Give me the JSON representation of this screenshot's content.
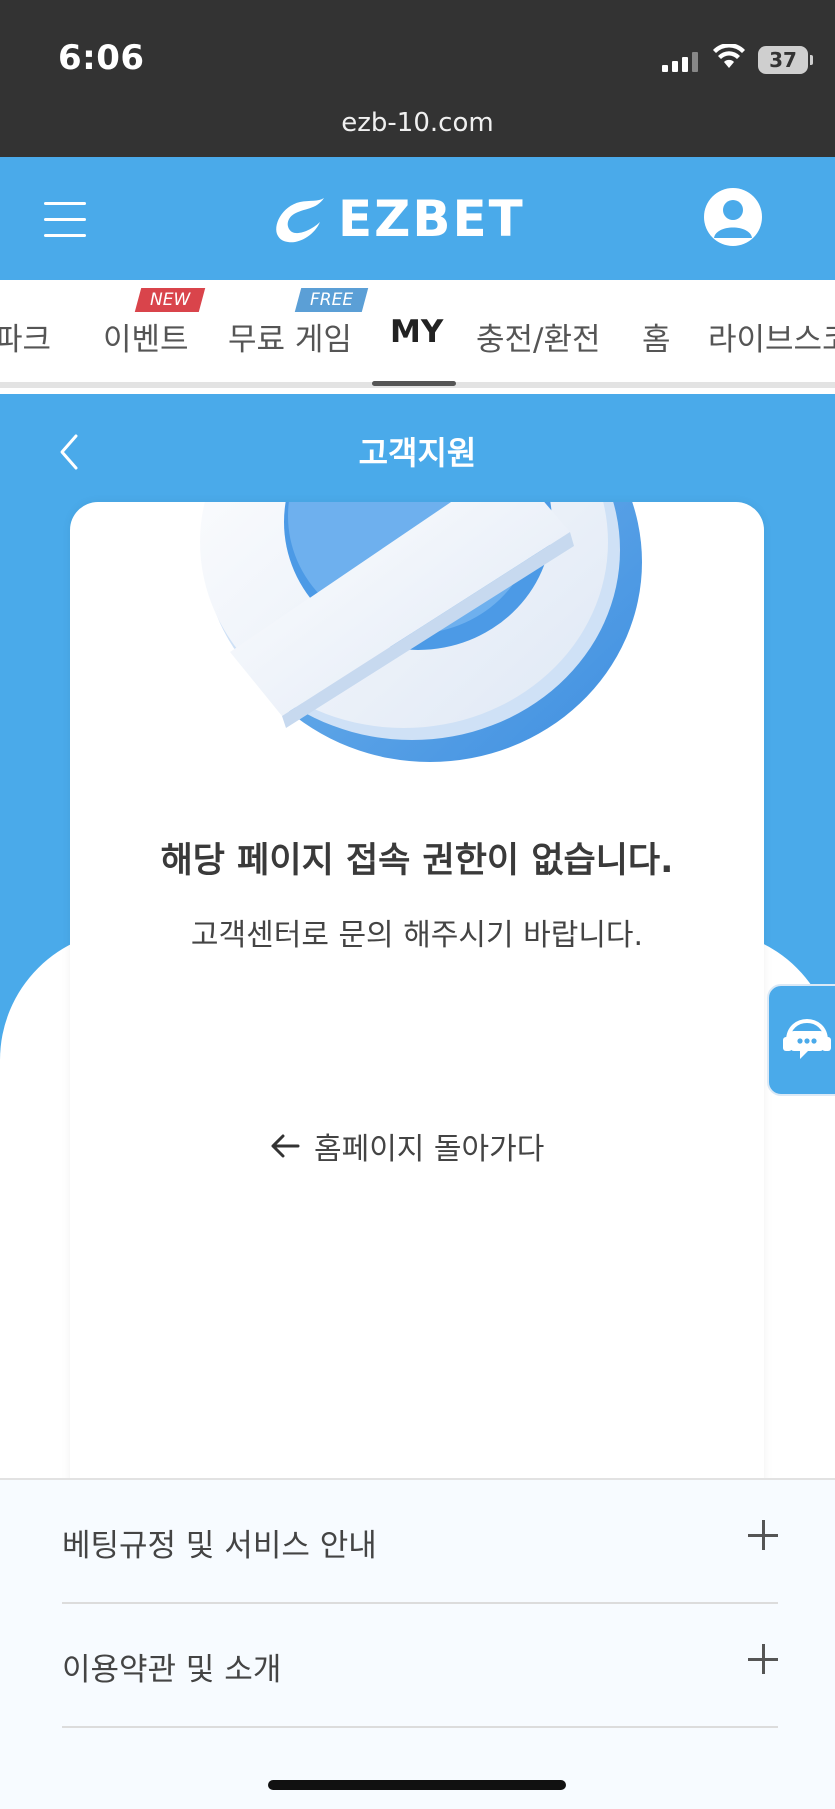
{
  "status_bar": {
    "time": "6:06",
    "battery": "37",
    "url": "ezb-10.com"
  },
  "header": {
    "logo_text": "EZBET",
    "brand_color": "#4aaaea"
  },
  "nav": {
    "tabs": [
      "파크",
      "이벤트",
      "무료 게임",
      "MY",
      "충전/환전",
      "홈",
      "라이브스코"
    ],
    "active_tab": "MY",
    "badge_new": "NEW",
    "badge_free": "FREE"
  },
  "page": {
    "title": "고객지원"
  },
  "message": {
    "title": "해당 페이지 접속 권한이 없습니다.",
    "subtitle": "고객센터로 문의 해주시기 바랍니다.",
    "home_link": "홈페이지 돌아가다"
  },
  "accordion": [
    {
      "label": "베팅규정 및 서비스 안내"
    },
    {
      "label": "이용약관 및 소개"
    }
  ],
  "icons": [
    "menu-icon",
    "user-icon",
    "back-icon",
    "arrow-left-icon",
    "headset-chat-icon",
    "plus-icon"
  ]
}
